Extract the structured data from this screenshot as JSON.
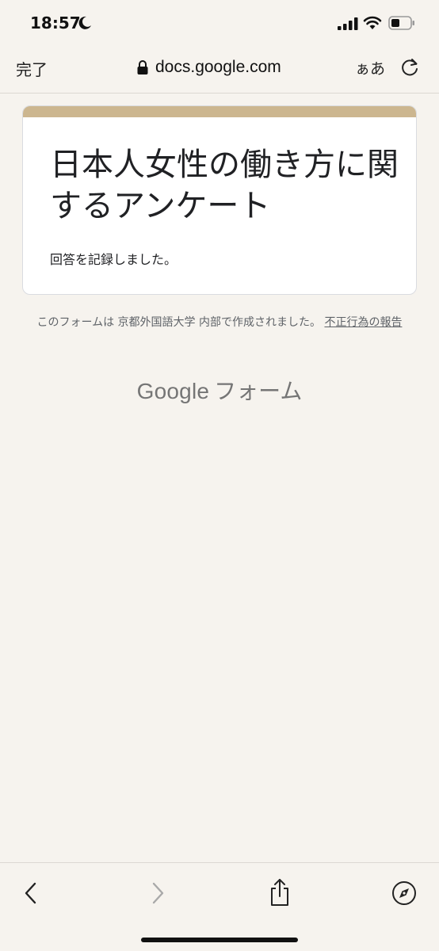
{
  "status_bar": {
    "time": "18:57",
    "icons": [
      "moon-icon",
      "signal-icon",
      "wifi-icon",
      "battery-icon"
    ]
  },
  "browser": {
    "done_label": "完了",
    "url": "docs.google.com",
    "text_size_label": "ぁあ",
    "icons": [
      "lock-icon",
      "reload-icon"
    ]
  },
  "form": {
    "title": "日本人女性の働き方に関するアンケート",
    "message": "回答を記録しました。",
    "accent_color": "#ccb68f"
  },
  "footer": {
    "note": "このフォームは 京都外国語大学 内部で作成されました。",
    "report_link": "不正行為の報告",
    "brand_google": "Google",
    "brand_forms": "フォーム"
  },
  "bottom_bar": {
    "icons": [
      "back-icon",
      "forward-icon",
      "share-icon",
      "compass-icon"
    ]
  },
  "colors": {
    "background": "#f6f3ee",
    "card": "#ffffff",
    "text_muted": "#5f6368"
  }
}
